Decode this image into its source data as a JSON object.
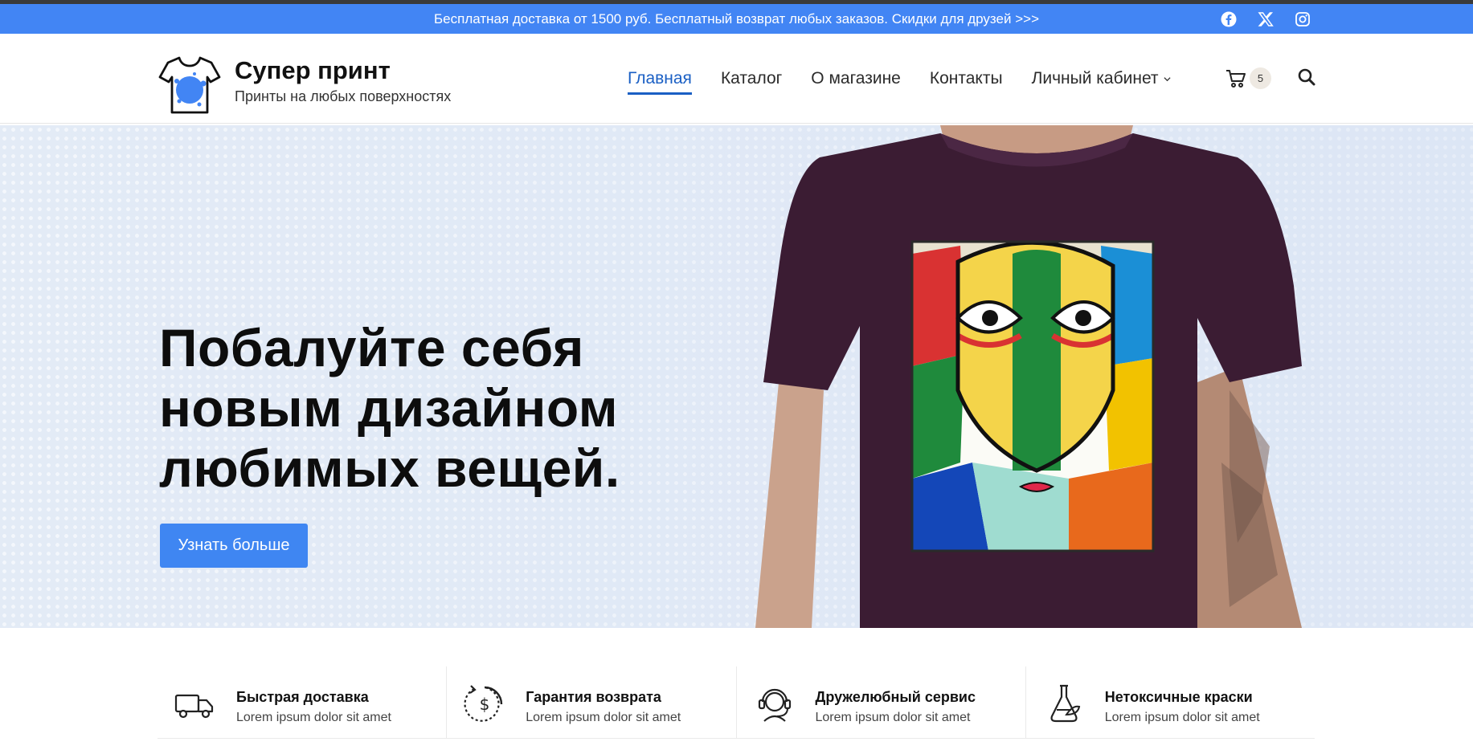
{
  "topbar": {
    "promo": "Бесплатная доставка от 1500 руб. Бесплатный возврат любых заказов. Скидки для друзей >>>",
    "socials": [
      "facebook-icon",
      "x-twitter-icon",
      "instagram-icon"
    ]
  },
  "brand": {
    "name": "Супер принт",
    "tagline": "Принты на любых поверхностях"
  },
  "nav": {
    "items": [
      "Главная",
      "Каталог",
      "О магазине",
      "Контакты",
      "Личный кабинет"
    ],
    "active": "Главная",
    "cart_count": "5"
  },
  "hero": {
    "title_line1": "Побалуйте себя",
    "title_line2": "новым дизайном",
    "title_line3": "любимых вещей.",
    "cta": "Узнать больше"
  },
  "features": [
    {
      "title": "Быстрая доставка",
      "text": "Lorem ipsum dolor sit amet",
      "icon": "truck-icon"
    },
    {
      "title": "Гарантия возврата",
      "text": "Lorem ipsum dolor sit amet",
      "icon": "money-back-icon"
    },
    {
      "title": "Дружелюбный сервис",
      "text": "Lorem ipsum dolor sit amet",
      "icon": "support-headset-icon"
    },
    {
      "title": "Нетоксичные краски",
      "text": "Lorem ipsum dolor sit amet",
      "icon": "eco-flask-icon"
    }
  ],
  "colors": {
    "accent": "#4285f4",
    "nav_active": "#1a5fc4",
    "shirt": "#3b1c33"
  }
}
